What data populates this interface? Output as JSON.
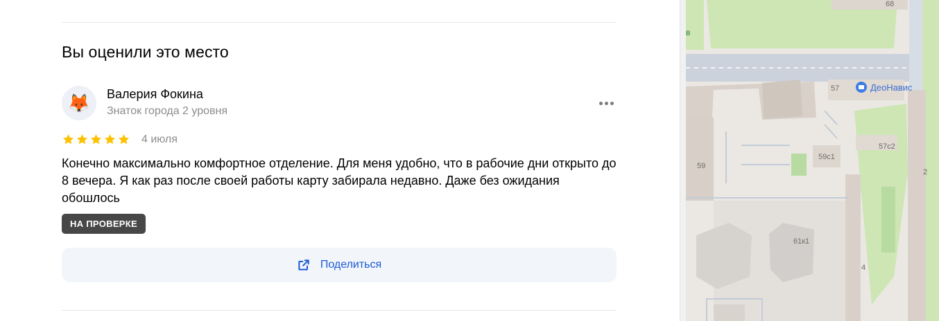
{
  "section": {
    "title": "Вы оценили это место"
  },
  "review": {
    "author": "Валерия Фокина",
    "author_level": "Знаток города 2 уровня",
    "avatar_emoji": "🦊",
    "rating": 5,
    "date": "4 июля",
    "text": "Конечно максимально комфортное отделение. Для меня удобно, что в рабочие дни открыто до 8 вечера. Я как раз после своей работы карту забирала недавно. Даже без ожидания обошлось",
    "status_badge": "НА ПРОВЕРКЕ",
    "share_label": "Поделиться"
  },
  "colors": {
    "star": "#fcc200",
    "link": "#1a5ad6",
    "badge": "#474747"
  },
  "icons": {
    "more": "more-horizontal-icon",
    "share": "share-external-icon",
    "star": "star-icon"
  },
  "map": {
    "labels": {
      "b68": "68",
      "b57": "57",
      "poi": "ДеоНавис",
      "b57c2": "57с2",
      "b59c1": "59с1",
      "b59": "59",
      "b2": "2",
      "b61k1": "61к1",
      "b4": "4",
      "edge_b": "в"
    }
  }
}
